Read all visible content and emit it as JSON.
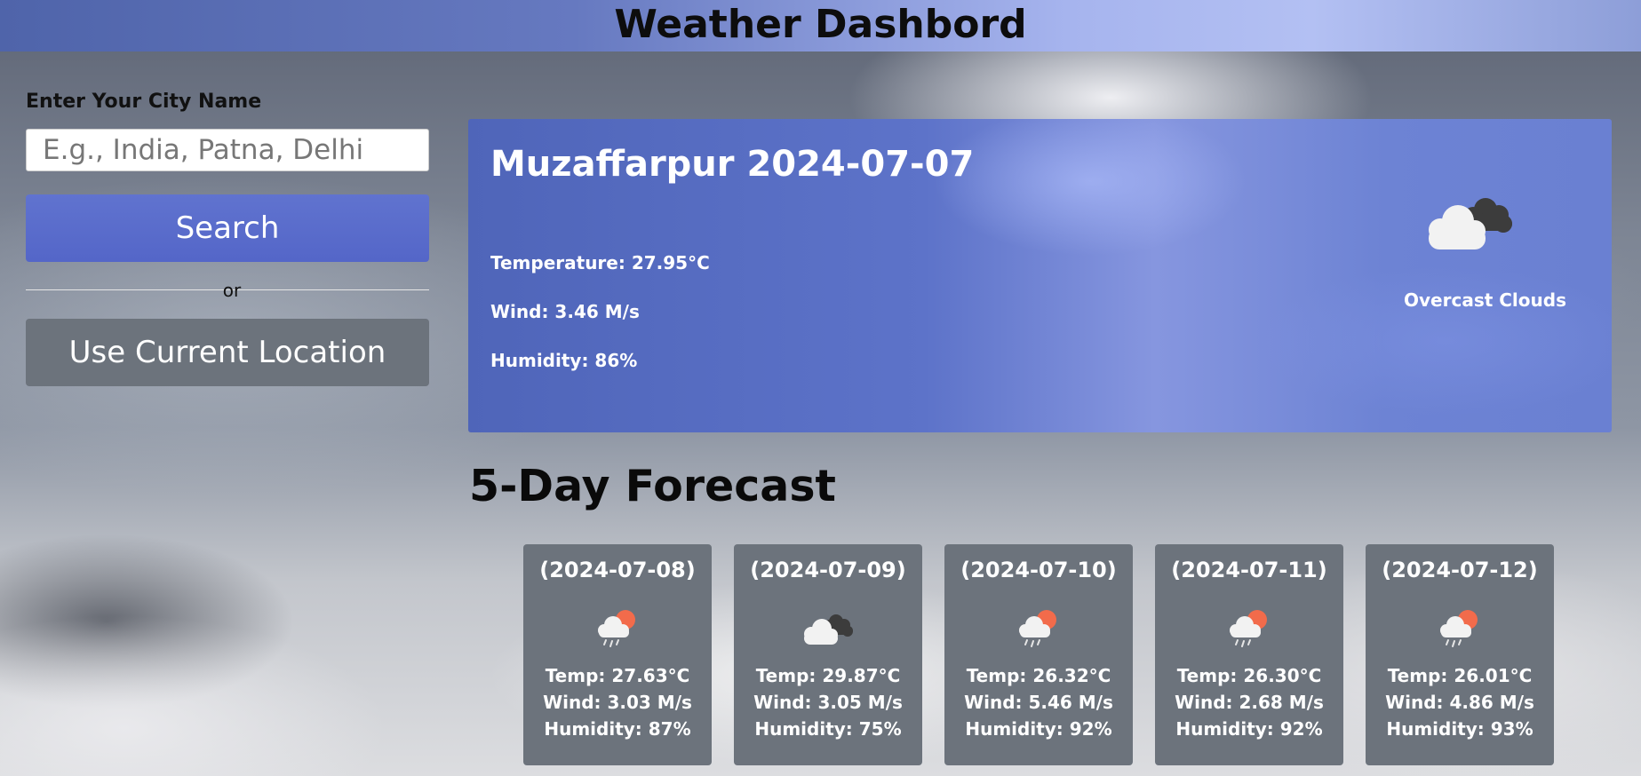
{
  "header": {
    "title": "Weather Dashbord"
  },
  "sidebar": {
    "city_label": "Enter Your City Name",
    "city_input": {
      "placeholder": "E.g., India, Patna, Delhi",
      "value": ""
    },
    "search_label": "Search",
    "divider_text": "or",
    "location_label": "Use Current Location"
  },
  "current": {
    "title": "Muzaffarpur 2024-07-07",
    "temperature": "Temperature: 27.95°C",
    "wind": "Wind: 3.46 M/s",
    "humidity": "Humidity: 86%",
    "description": "Overcast Clouds",
    "icon": "overcast-clouds-icon"
  },
  "forecast": {
    "title": "5-Day Forecast",
    "days": [
      {
        "date": "(2024-07-08)",
        "icon": "light-rain-icon",
        "temp": "Temp: 27.63°C",
        "wind": "Wind: 3.03 M/s",
        "humidity": "Humidity: 87%"
      },
      {
        "date": "(2024-07-09)",
        "icon": "overcast-clouds-icon",
        "temp": "Temp: 29.87°C",
        "wind": "Wind: 3.05 M/s",
        "humidity": "Humidity: 75%"
      },
      {
        "date": "(2024-07-10)",
        "icon": "light-rain-icon",
        "temp": "Temp: 26.32°C",
        "wind": "Wind: 5.46 M/s",
        "humidity": "Humidity: 92%"
      },
      {
        "date": "(2024-07-11)",
        "icon": "light-rain-icon",
        "temp": "Temp: 26.30°C",
        "wind": "Wind: 2.68 M/s",
        "humidity": "Humidity: 92%"
      },
      {
        "date": "(2024-07-12)",
        "icon": "light-rain-icon",
        "temp": "Temp: 26.01°C",
        "wind": "Wind: 4.86 M/s",
        "humidity": "Humidity: 93%"
      }
    ]
  },
  "colors": {
    "header_gradient_start": "#4f64aa",
    "header_gradient_end": "#b3c0f3",
    "search_button": "#5466c8",
    "location_button": "#6c737c",
    "card_background": "#6c737c",
    "current_panel": "#5d73c9",
    "sun": "#f26b4b"
  }
}
